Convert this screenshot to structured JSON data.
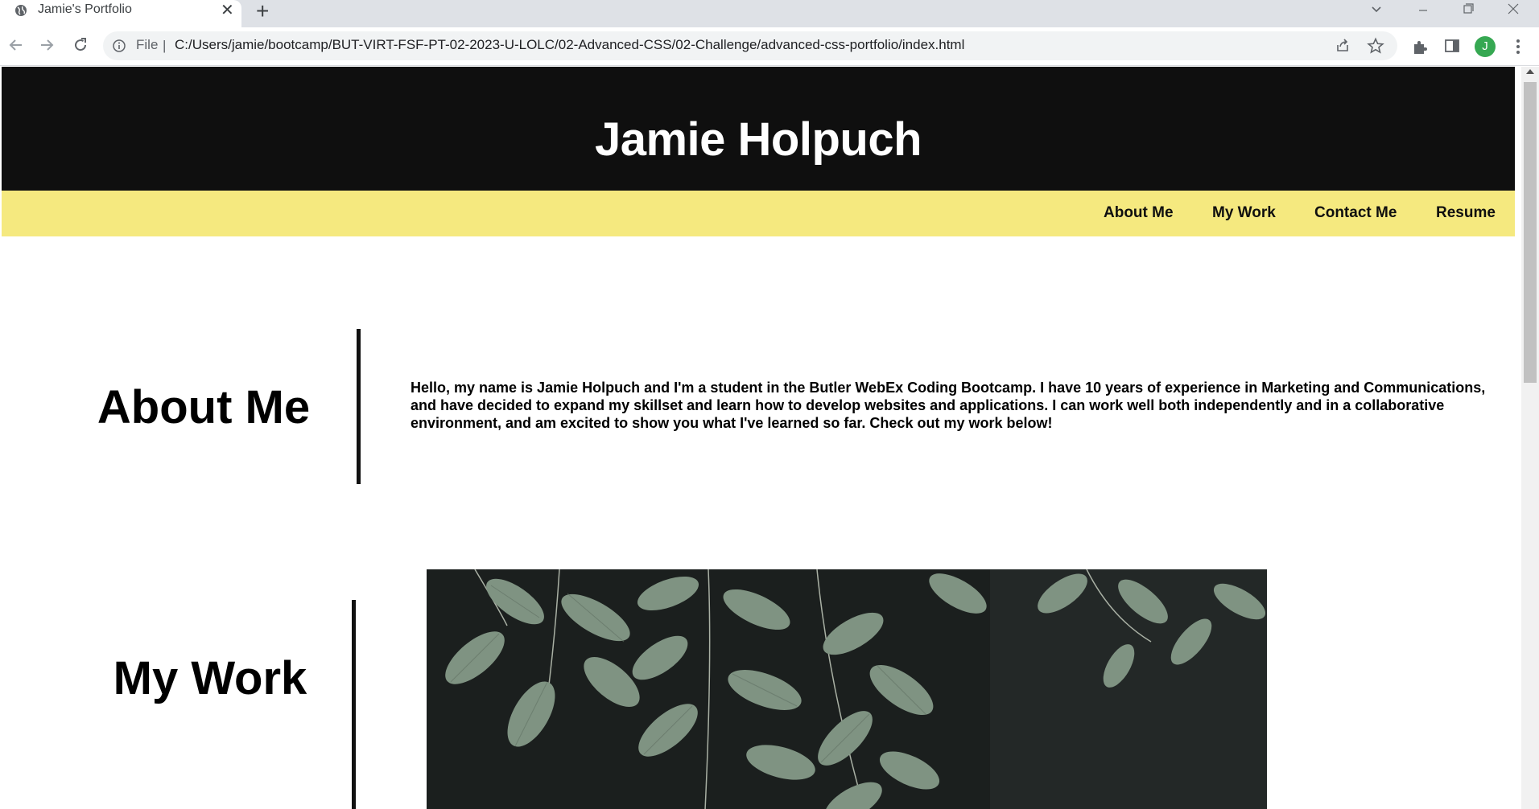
{
  "browser": {
    "tab_title": "Jamie's Portfolio",
    "omnibox_scheme": "File",
    "omnibox_separator": "|",
    "url": "C:/Users/jamie/bootcamp/BUT-VIRT-FSF-PT-02-2023-U-LOLC/02-Advanced-CSS/02-Challenge/advanced-css-portfolio/index.html",
    "profile_initial": "J",
    "profile_color": "#36a852"
  },
  "page": {
    "site_title": "Jamie Holpuch",
    "nav": [
      "About Me",
      "My Work",
      "Contact Me",
      "Resume"
    ],
    "about": {
      "heading": "About Me",
      "text": "Hello, my name is Jamie Holpuch and I'm a student in the Butler WebEx Coding Bootcamp. I have 10 years of experience in Marketing and Communications, and have decided to expand my skillset and learn how to develop websites and applications. I can work well both independently and in a collaborative environment, and am excited to show you what I've learned so far. Check out my work below!"
    },
    "work": {
      "heading": "My Work",
      "image_subject": "green leaves on dark background"
    },
    "colors": {
      "header_bg": "#0f0f0f",
      "nav_bg": "#f5e97f",
      "heading_text": "#000000"
    }
  }
}
